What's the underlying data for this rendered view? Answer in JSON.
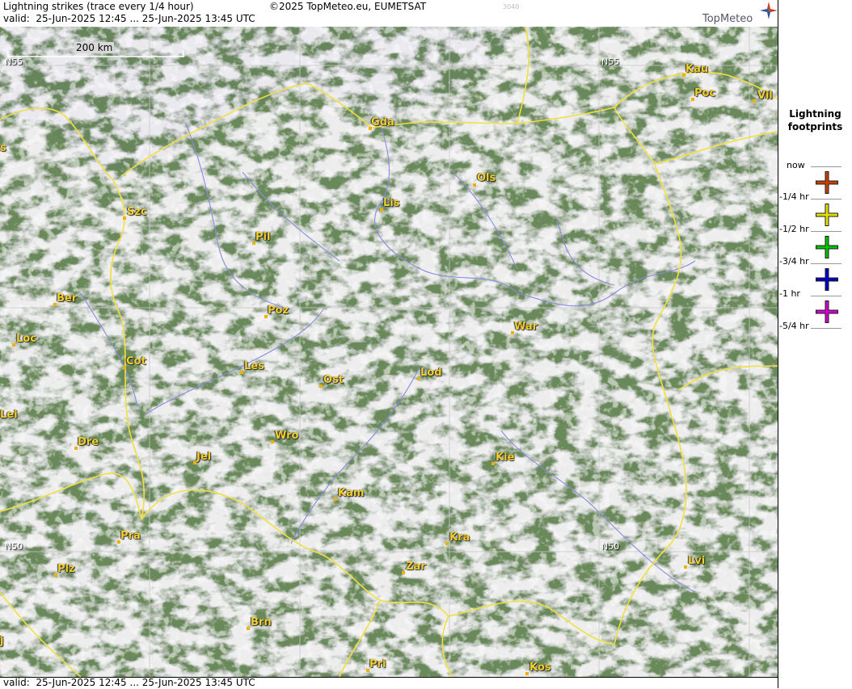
{
  "header": {
    "title": "Lightning strikes (trace every 1/4 hour)",
    "copyright": "©2025 TopMeteo.eu, EUMETSAT",
    "code": "3040",
    "valid": "valid:  25-Jun-2025 12:45 ... 25-Jun-2025 13:45 UTC",
    "logo_text": "TopMeteo"
  },
  "footer": {
    "valid": "valid:  25-Jun-2025 12:45 ... 25-Jun-2025 13:45 UTC"
  },
  "map": {
    "scale_label": "200 km",
    "grid_labels": [
      "N55",
      "N55",
      "N50",
      "N50"
    ],
    "cities": [
      {
        "name": "Gda"
      },
      {
        "name": "Kau"
      },
      {
        "name": "Poc"
      },
      {
        "name": "Vil"
      },
      {
        "name": "Ols"
      },
      {
        "name": "Lis"
      },
      {
        "name": "Szc"
      },
      {
        "name": "Pil"
      },
      {
        "name": "Ber"
      },
      {
        "name": "Poz"
      },
      {
        "name": "War"
      },
      {
        "name": "Loc"
      },
      {
        "name": "Cot"
      },
      {
        "name": "Les"
      },
      {
        "name": "Ost"
      },
      {
        "name": "Lod"
      },
      {
        "name": "Lei"
      },
      {
        "name": "Dre"
      },
      {
        "name": "Wro"
      },
      {
        "name": "Jel"
      },
      {
        "name": "Kie"
      },
      {
        "name": "Kam"
      },
      {
        "name": "Pra"
      },
      {
        "name": "Kra"
      },
      {
        "name": "Plz"
      },
      {
        "name": "Zar"
      },
      {
        "name": "Lvi"
      },
      {
        "name": "Brn"
      },
      {
        "name": "Pri"
      },
      {
        "name": "Kos"
      },
      {
        "name": "s"
      },
      {
        "name": "j"
      }
    ]
  },
  "legend": {
    "title": "Lightning footprints",
    "rows": [
      {
        "label": "now",
        "color": "#c84000"
      },
      {
        "label": "-1/4 hr",
        "color": "#e0e000"
      },
      {
        "label": "-1/2 hr",
        "color": "#00c000"
      },
      {
        "label": "-3/4 hr",
        "color": "#0000c0"
      },
      {
        "label": "-1 hr",
        "color": "#d000d0"
      },
      {
        "label": "-5/4 hr",
        "color": ""
      }
    ]
  },
  "colors": {
    "border": "#f0e040",
    "grid": "#c8c8c8",
    "river": "#8a8ae0",
    "sea": "#1a2a55",
    "land": "#4d7a44",
    "cloud": "#e8e6ea"
  }
}
